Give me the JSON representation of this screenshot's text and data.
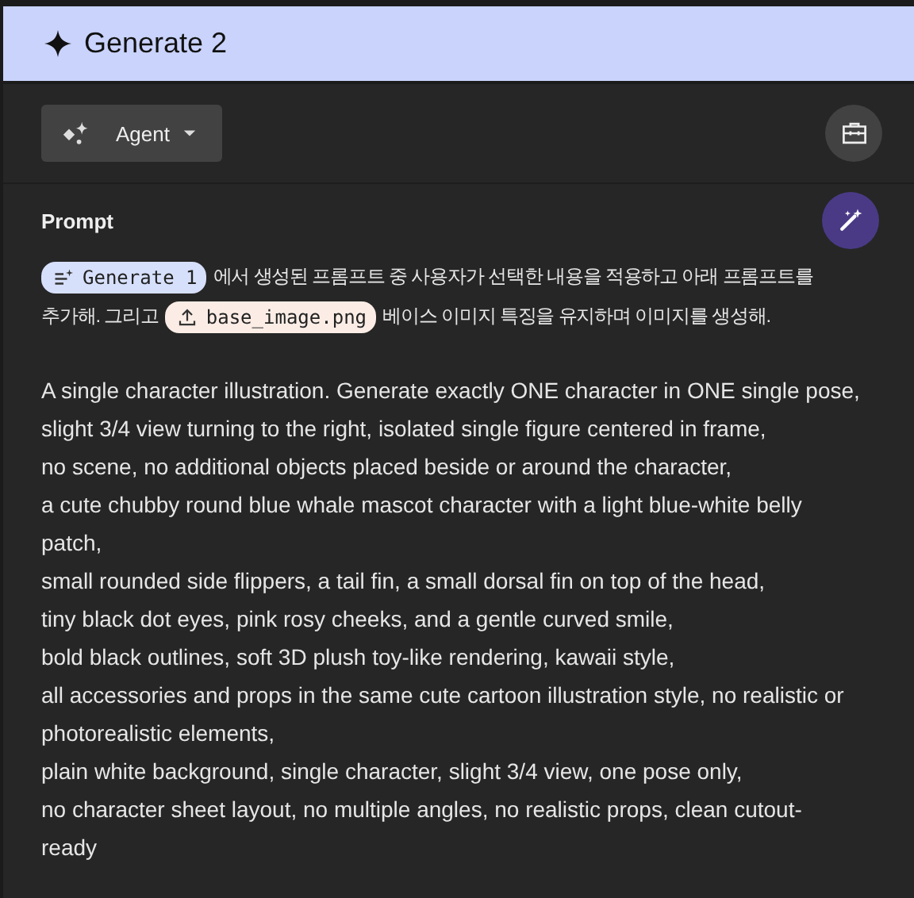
{
  "header": {
    "title": "Generate 2"
  },
  "toolbar": {
    "mode_button": {
      "label": "Agent"
    }
  },
  "prompt": {
    "label": "Prompt",
    "intro": [
      [
        {
          "kind": "generation",
          "label": "Generate 1"
        },
        {
          "kind": "text",
          "text": "에서 생성된 프롬프트 중 사용자가 선택한 내용을 적용하고 아래 프롬프트를"
        }
      ],
      [
        {
          "kind": "text",
          "text": "추가해. 그리고"
        },
        {
          "kind": "file",
          "label": "base_image.png"
        },
        {
          "kind": "text",
          "text": "베이스 이미지 특징을 유지하며 이미지를 생성해."
        }
      ]
    ],
    "lines": [
      "A single character illustration. Generate exactly ONE character in ONE single pose,",
      "slight 3/4 view turning to the right, isolated single figure centered in frame,",
      "no scene, no additional objects placed beside or around the character,",
      "a cute chubby round blue whale mascot character with a light blue-white belly",
      "patch,",
      "small rounded side flippers, a tail fin, a small dorsal fin on top of the head,",
      "tiny black dot eyes, pink rosy cheeks, and a gentle curved smile,",
      "bold black outlines, soft 3D plush toy-like rendering, kawaii style,",
      "all accessories and props in the same cute cartoon illustration style, no realistic or",
      "photorealistic elements,",
      "plain white background, single character, slight 3/4 view, one pose only,",
      "no character sheet layout, no multiple angles, no realistic props, clean cutout-",
      "ready"
    ]
  }
}
